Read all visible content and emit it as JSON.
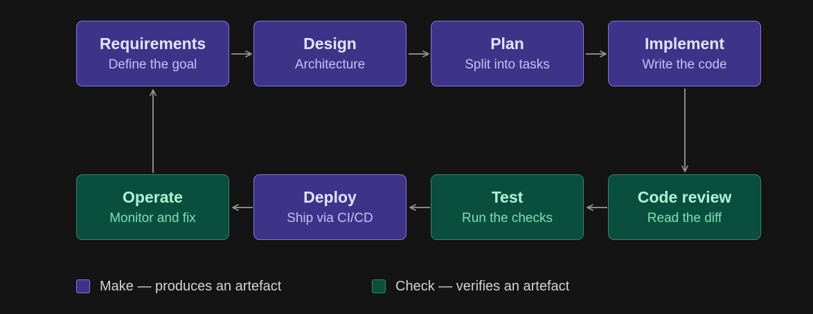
{
  "nodes": {
    "requirements": {
      "title": "Requirements",
      "subtitle": "Define the goal",
      "kind": "make"
    },
    "design": {
      "title": "Design",
      "subtitle": "Architecture",
      "kind": "make"
    },
    "plan": {
      "title": "Plan",
      "subtitle": "Split into tasks",
      "kind": "make"
    },
    "implement": {
      "title": "Implement",
      "subtitle": "Write the code",
      "kind": "make"
    },
    "code_review": {
      "title": "Code review",
      "subtitle": "Read the diff",
      "kind": "check"
    },
    "test": {
      "title": "Test",
      "subtitle": "Run the checks",
      "kind": "check"
    },
    "deploy": {
      "title": "Deploy",
      "subtitle": "Ship via CI/CD",
      "kind": "make"
    },
    "operate": {
      "title": "Operate",
      "subtitle": "Monitor and fix",
      "kind": "check"
    }
  },
  "flow": [
    "requirements",
    "design",
    "plan",
    "implement",
    "code_review",
    "test",
    "deploy",
    "operate",
    "requirements"
  ],
  "legend": {
    "make": {
      "label": "Make — produces an artefact",
      "color": "#3d3489"
    },
    "check": {
      "label": "Check — verifies an artefact",
      "color": "#0a4f3e"
    }
  },
  "colors": {
    "background": "#141414",
    "arrow": "#9a9891",
    "make_border": "#8478d6",
    "check_border": "#2f8a6b"
  }
}
